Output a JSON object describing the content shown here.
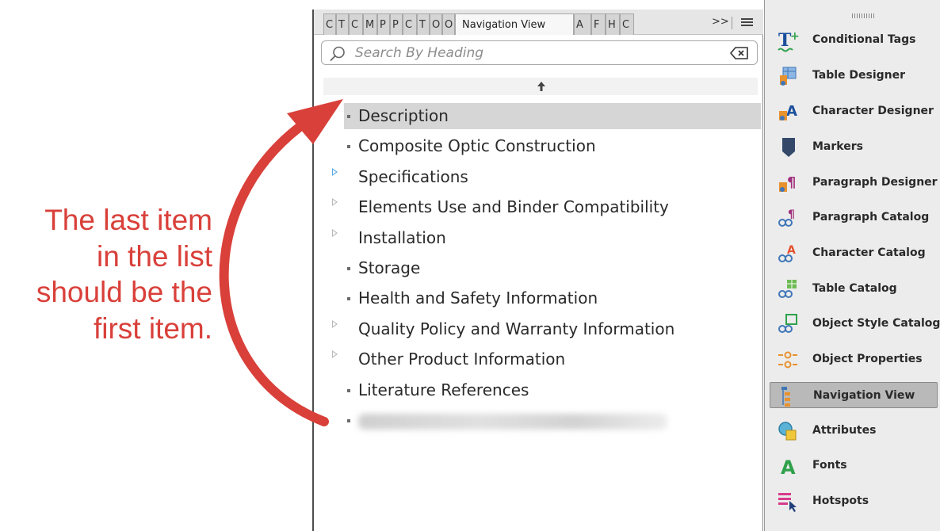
{
  "annotation": {
    "lines": [
      "The last item",
      "in the list",
      "should be the",
      "first item."
    ],
    "color": "#d9403a"
  },
  "nav_panel": {
    "tabs": [
      {
        "label": "C"
      },
      {
        "label": "T"
      },
      {
        "label": "C"
      },
      {
        "label": "M"
      },
      {
        "label": "P"
      },
      {
        "label": "P"
      },
      {
        "label": "C"
      },
      {
        "label": "T"
      },
      {
        "label": "O"
      },
      {
        "label": "O"
      },
      {
        "label": "Navigation View",
        "active": true
      },
      {
        "label": "A"
      },
      {
        "label": "F"
      },
      {
        "label": "H"
      },
      {
        "label": "C"
      }
    ],
    "overflow_label": ">>",
    "search": {
      "placeholder": "Search By Heading",
      "value": ""
    },
    "tree": [
      {
        "label": "Description",
        "type": "leaf",
        "selected": true
      },
      {
        "label": "Composite Optic Construction",
        "type": "leaf"
      },
      {
        "label": "Specifications",
        "type": "expandable",
        "highlight": true
      },
      {
        "label": "Elements Use and Binder Compatibility",
        "type": "expandable"
      },
      {
        "label": "Installation",
        "type": "expandable"
      },
      {
        "label": "Storage",
        "type": "leaf"
      },
      {
        "label": "Health and Safety Information",
        "type": "leaf"
      },
      {
        "label": "Quality Policy and Warranty Information",
        "type": "expandable"
      },
      {
        "label": "Other Product Information",
        "type": "expandable"
      },
      {
        "label": "Literature References",
        "type": "leaf"
      },
      {
        "label": "",
        "type": "leaf",
        "blurred": true
      }
    ]
  },
  "panels": [
    {
      "label": "Conditional Tags",
      "icon": "conditional-tags-icon"
    },
    {
      "label": "Table Designer",
      "icon": "table-designer-icon"
    },
    {
      "label": "Character Designer",
      "icon": "character-designer-icon"
    },
    {
      "label": "Markers",
      "icon": "markers-icon"
    },
    {
      "label": "Paragraph Designer",
      "icon": "paragraph-designer-icon"
    },
    {
      "label": "Paragraph Catalog",
      "icon": "paragraph-catalog-icon"
    },
    {
      "label": "Character Catalog",
      "icon": "character-catalog-icon"
    },
    {
      "label": "Table Catalog",
      "icon": "table-catalog-icon"
    },
    {
      "label": "Object Style Catalog",
      "icon": "object-style-catalog-icon"
    },
    {
      "label": "Object Properties",
      "icon": "object-properties-icon"
    },
    {
      "label": "Navigation View",
      "icon": "navigation-view-icon",
      "active": true
    },
    {
      "label": "Attributes",
      "icon": "attributes-icon"
    },
    {
      "label": "Fonts",
      "icon": "fonts-icon"
    },
    {
      "label": "Hotspots",
      "icon": "hotspots-icon"
    }
  ]
}
